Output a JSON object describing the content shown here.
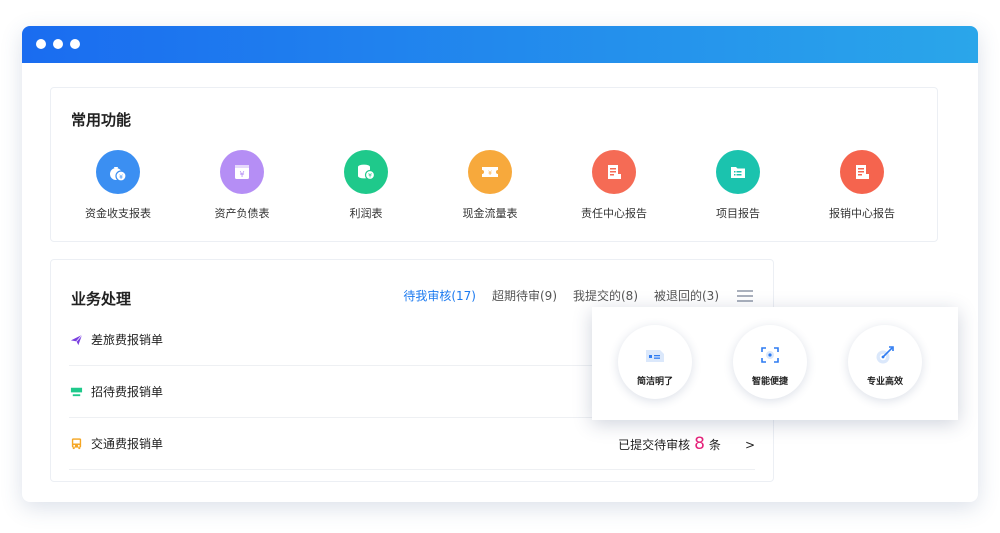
{
  "common": {
    "title": "常用功能",
    "items": [
      {
        "label": "资金收支报表",
        "color": "#3b8ff2"
      },
      {
        "label": "资产负债表",
        "color": "#b58ef5"
      },
      {
        "label": "利润表",
        "color": "#1fc98b"
      },
      {
        "label": "现金流量表",
        "color": "#f7a93c"
      },
      {
        "label": "责任中心报告",
        "color": "#f56b55"
      },
      {
        "label": "项目报告",
        "color": "#1bc3ae"
      },
      {
        "label": "报销中心报告",
        "color": "#f5644e"
      }
    ]
  },
  "business": {
    "title": "业务处理",
    "tabs": [
      "待我审核(17)",
      "超期待审(9)",
      "我提交的(8)",
      "被退回的(3)"
    ],
    "rows": [
      {
        "label": "差旅费报销单",
        "icon_color": "#7a3fe0"
      },
      {
        "label": "招待费报销单",
        "icon_color": "#1fc98b"
      },
      {
        "label": "交通费报销单",
        "icon_color": "#f5a623",
        "status_prefix": "已提交待审核",
        "count": "8",
        "unit": "条",
        "chevron": ">"
      }
    ]
  },
  "features": [
    {
      "label": "简洁明了"
    },
    {
      "label": "智能便捷"
    },
    {
      "label": "专业高效"
    }
  ]
}
